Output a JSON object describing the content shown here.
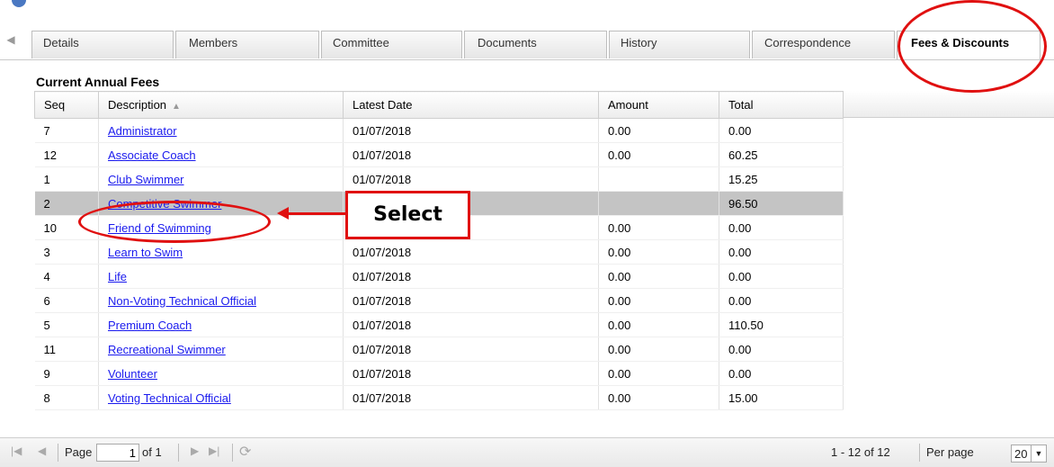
{
  "tabs": [
    {
      "label": "Details"
    },
    {
      "label": "Members"
    },
    {
      "label": "Committee"
    },
    {
      "label": "Documents"
    },
    {
      "label": "History"
    },
    {
      "label": "Correspondence"
    },
    {
      "label": "Fees & Discounts",
      "active": true
    }
  ],
  "section_title": "Current Annual Fees",
  "table": {
    "columns": [
      "Seq",
      "Description",
      "Latest Date",
      "Amount",
      "Total"
    ],
    "sort_column": "Description",
    "sort_direction": "ascending",
    "selected_row": 3,
    "rows": [
      {
        "seq": "7",
        "description": "Administrator",
        "date": "01/07/2018",
        "amount": "0.00",
        "total": "0.00"
      },
      {
        "seq": "12",
        "description": "Associate Coach",
        "date": "01/07/2018",
        "amount": "0.00",
        "total": "60.25"
      },
      {
        "seq": "1",
        "description": "Club Swimmer",
        "date": "01/07/2018",
        "amount": "",
        "total": "15.25"
      },
      {
        "seq": "2",
        "description": "Competitive Swimmer",
        "date": "",
        "amount": "",
        "total": "96.50"
      },
      {
        "seq": "10",
        "description": "Friend of Swimming",
        "date": "01/07/2018",
        "amount": "0.00",
        "total": "0.00"
      },
      {
        "seq": "3",
        "description": "Learn to Swim",
        "date": "01/07/2018",
        "amount": "0.00",
        "total": "0.00"
      },
      {
        "seq": "4",
        "description": "Life",
        "date": "01/07/2018",
        "amount": "0.00",
        "total": "0.00"
      },
      {
        "seq": "6",
        "description": "Non-Voting Technical Official",
        "date": "01/07/2018",
        "amount": "0.00",
        "total": "0.00"
      },
      {
        "seq": "5",
        "description": "Premium Coach",
        "date": "01/07/2018",
        "amount": "0.00",
        "total": "110.50"
      },
      {
        "seq": "11",
        "description": "Recreational Swimmer",
        "date": "01/07/2018",
        "amount": "0.00",
        "total": "0.00"
      },
      {
        "seq": "9",
        "description": "Volunteer",
        "date": "01/07/2018",
        "amount": "0.00",
        "total": "0.00"
      },
      {
        "seq": "8",
        "description": "Voting Technical Official",
        "date": "01/07/2018",
        "amount": "0.00",
        "total": "15.00"
      }
    ]
  },
  "pager": {
    "page_label": "Page",
    "page_value": "1",
    "of_label": "of 1",
    "range_text": "1 - 12 of 12",
    "per_page_label": "Per page",
    "per_page_value": "20"
  },
  "annotation": {
    "label": "Select",
    "color": "#e01010"
  },
  "icons": {
    "scroll_left": "arrow-left-icon",
    "first_page": "first-page-icon",
    "prev_page": "prev-page-icon",
    "next_page": "next-page-icon",
    "last_page": "last-page-icon",
    "refresh": "refresh-icon",
    "dropdown": "chevron-down-icon"
  },
  "colors": {
    "link": "#1a1aee",
    "selected_row": "#c4c4c4",
    "annotation": "#e01010"
  }
}
